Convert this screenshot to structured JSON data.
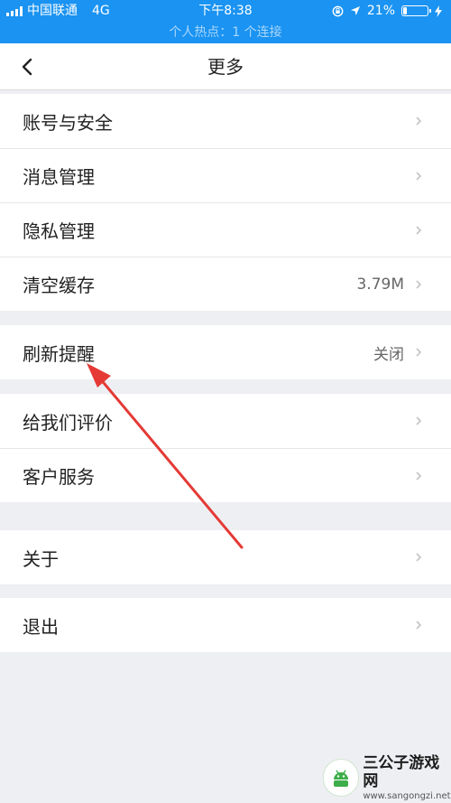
{
  "status_bar": {
    "carrier": "中国联通",
    "network": "4G",
    "time": "下午8:38",
    "battery_text": "21%",
    "battery_level": 0.21,
    "hotspot_text": "个人热点：1 个连接",
    "icons": [
      "signal-icon",
      "lock-rotation-icon",
      "location-icon",
      "battery-icon",
      "charging-icon"
    ]
  },
  "nav": {
    "title": "更多",
    "back_icon": "chevron-left-icon"
  },
  "menu": {
    "group1": [
      {
        "label": "账号与安全",
        "value": ""
      },
      {
        "label": "消息管理",
        "value": ""
      },
      {
        "label": "隐私管理",
        "value": ""
      },
      {
        "label": "清空缓存",
        "value": "3.79M"
      }
    ],
    "group2": [
      {
        "label": "刷新提醒",
        "value": "关闭"
      }
    ],
    "group3": [
      {
        "label": "给我们评价",
        "value": ""
      },
      {
        "label": "客户服务",
        "value": ""
      }
    ],
    "group4": [
      {
        "label": "关于",
        "value": ""
      }
    ],
    "group5": [
      {
        "label": "退出",
        "value": ""
      }
    ]
  },
  "annotation": {
    "arrow_color": "#e53935"
  },
  "watermark": {
    "title": "三公子游戏网",
    "url": "www.sangongzi.net"
  },
  "colors": {
    "status_bar_bg": "#1a93f2",
    "page_bg": "#eeeff3",
    "row_bg": "#ffffff"
  }
}
